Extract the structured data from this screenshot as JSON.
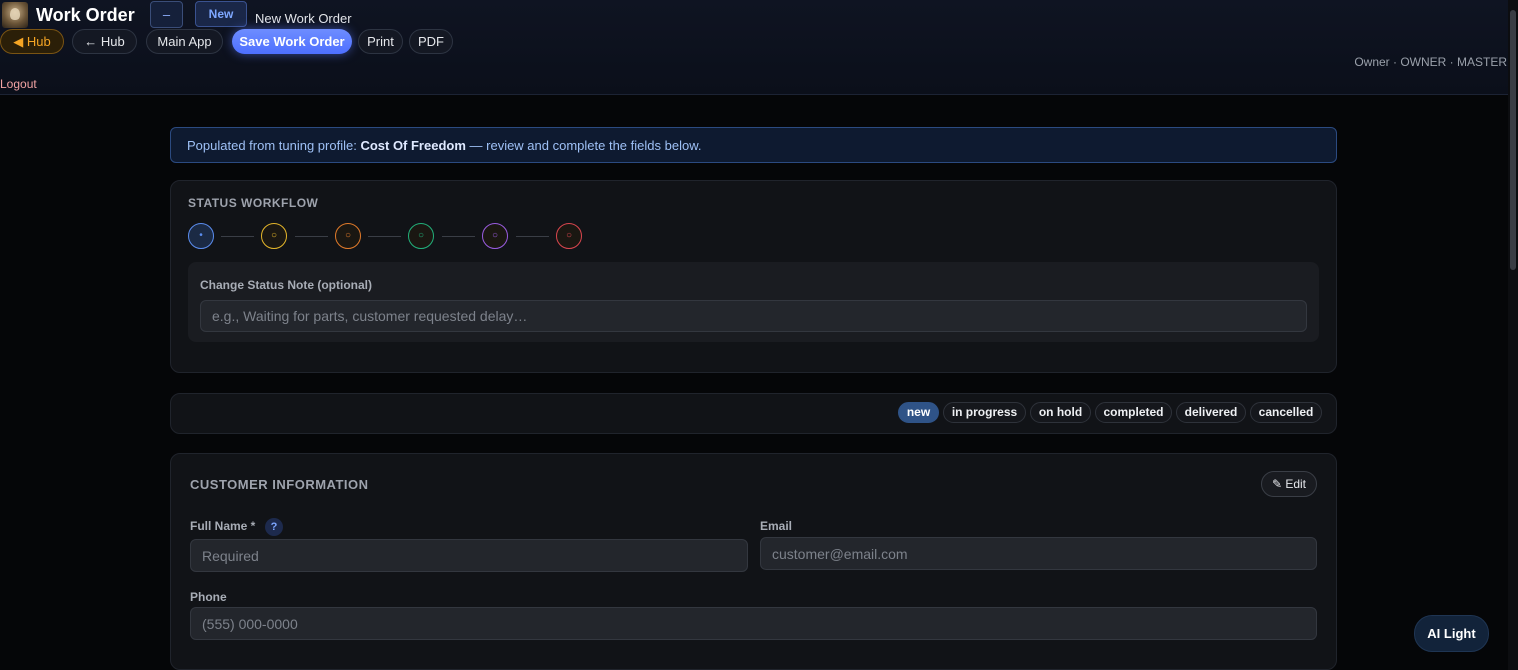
{
  "header": {
    "app_title": "Work Order",
    "dash_label": "–",
    "new_badge": "New",
    "subtitle": "New Work Order",
    "nav": {
      "hub": "◀ Hub",
      "hub_back": "← Hub",
      "main_app": "Main App",
      "save": "Save Work Order",
      "print": "Print",
      "pdf": "PDF"
    },
    "user_info": "Owner · OWNER · MASTER",
    "logout": "Logout"
  },
  "banner": {
    "prefix": "Populated from tuning profile: ",
    "profile": "Cost Of Freedom",
    "suffix": " — review and complete the fields below."
  },
  "status_workflow": {
    "title": "STATUS WORKFLOW",
    "steps": [
      {
        "symbol": "•",
        "color": "#5b8def",
        "state": "current"
      },
      {
        "symbol": "○",
        "color": "#e5b62a",
        "state": "pending"
      },
      {
        "symbol": "○",
        "color": "#e07a2a",
        "state": "pending"
      },
      {
        "symbol": "○",
        "color": "#22b07a",
        "state": "pending"
      },
      {
        "symbol": "○",
        "color": "#9a5ce0",
        "state": "pending"
      },
      {
        "symbol": "○",
        "color": "#d9464e",
        "state": "pending"
      }
    ],
    "note_label": "Change Status Note (optional)",
    "note_placeholder": "e.g., Waiting for parts, customer requested delay…",
    "note_value": ""
  },
  "status_tabs": [
    {
      "label": "new",
      "active": true
    },
    {
      "label": "in progress",
      "active": false
    },
    {
      "label": "on hold",
      "active": false
    },
    {
      "label": "completed",
      "active": false
    },
    {
      "label": "delivered",
      "active": false
    },
    {
      "label": "cancelled",
      "active": false
    }
  ],
  "customer": {
    "title": "CUSTOMER INFORMATION",
    "edit_label": "✎ Edit",
    "full_name": {
      "label": "Full Name *",
      "help": "?",
      "placeholder": "Required",
      "value": ""
    },
    "email": {
      "label": "Email",
      "placeholder": "customer@email.com",
      "value": ""
    },
    "phone": {
      "label": "Phone",
      "placeholder": "(555) 000-0000",
      "value": ""
    }
  },
  "ai_button": "AI Light"
}
